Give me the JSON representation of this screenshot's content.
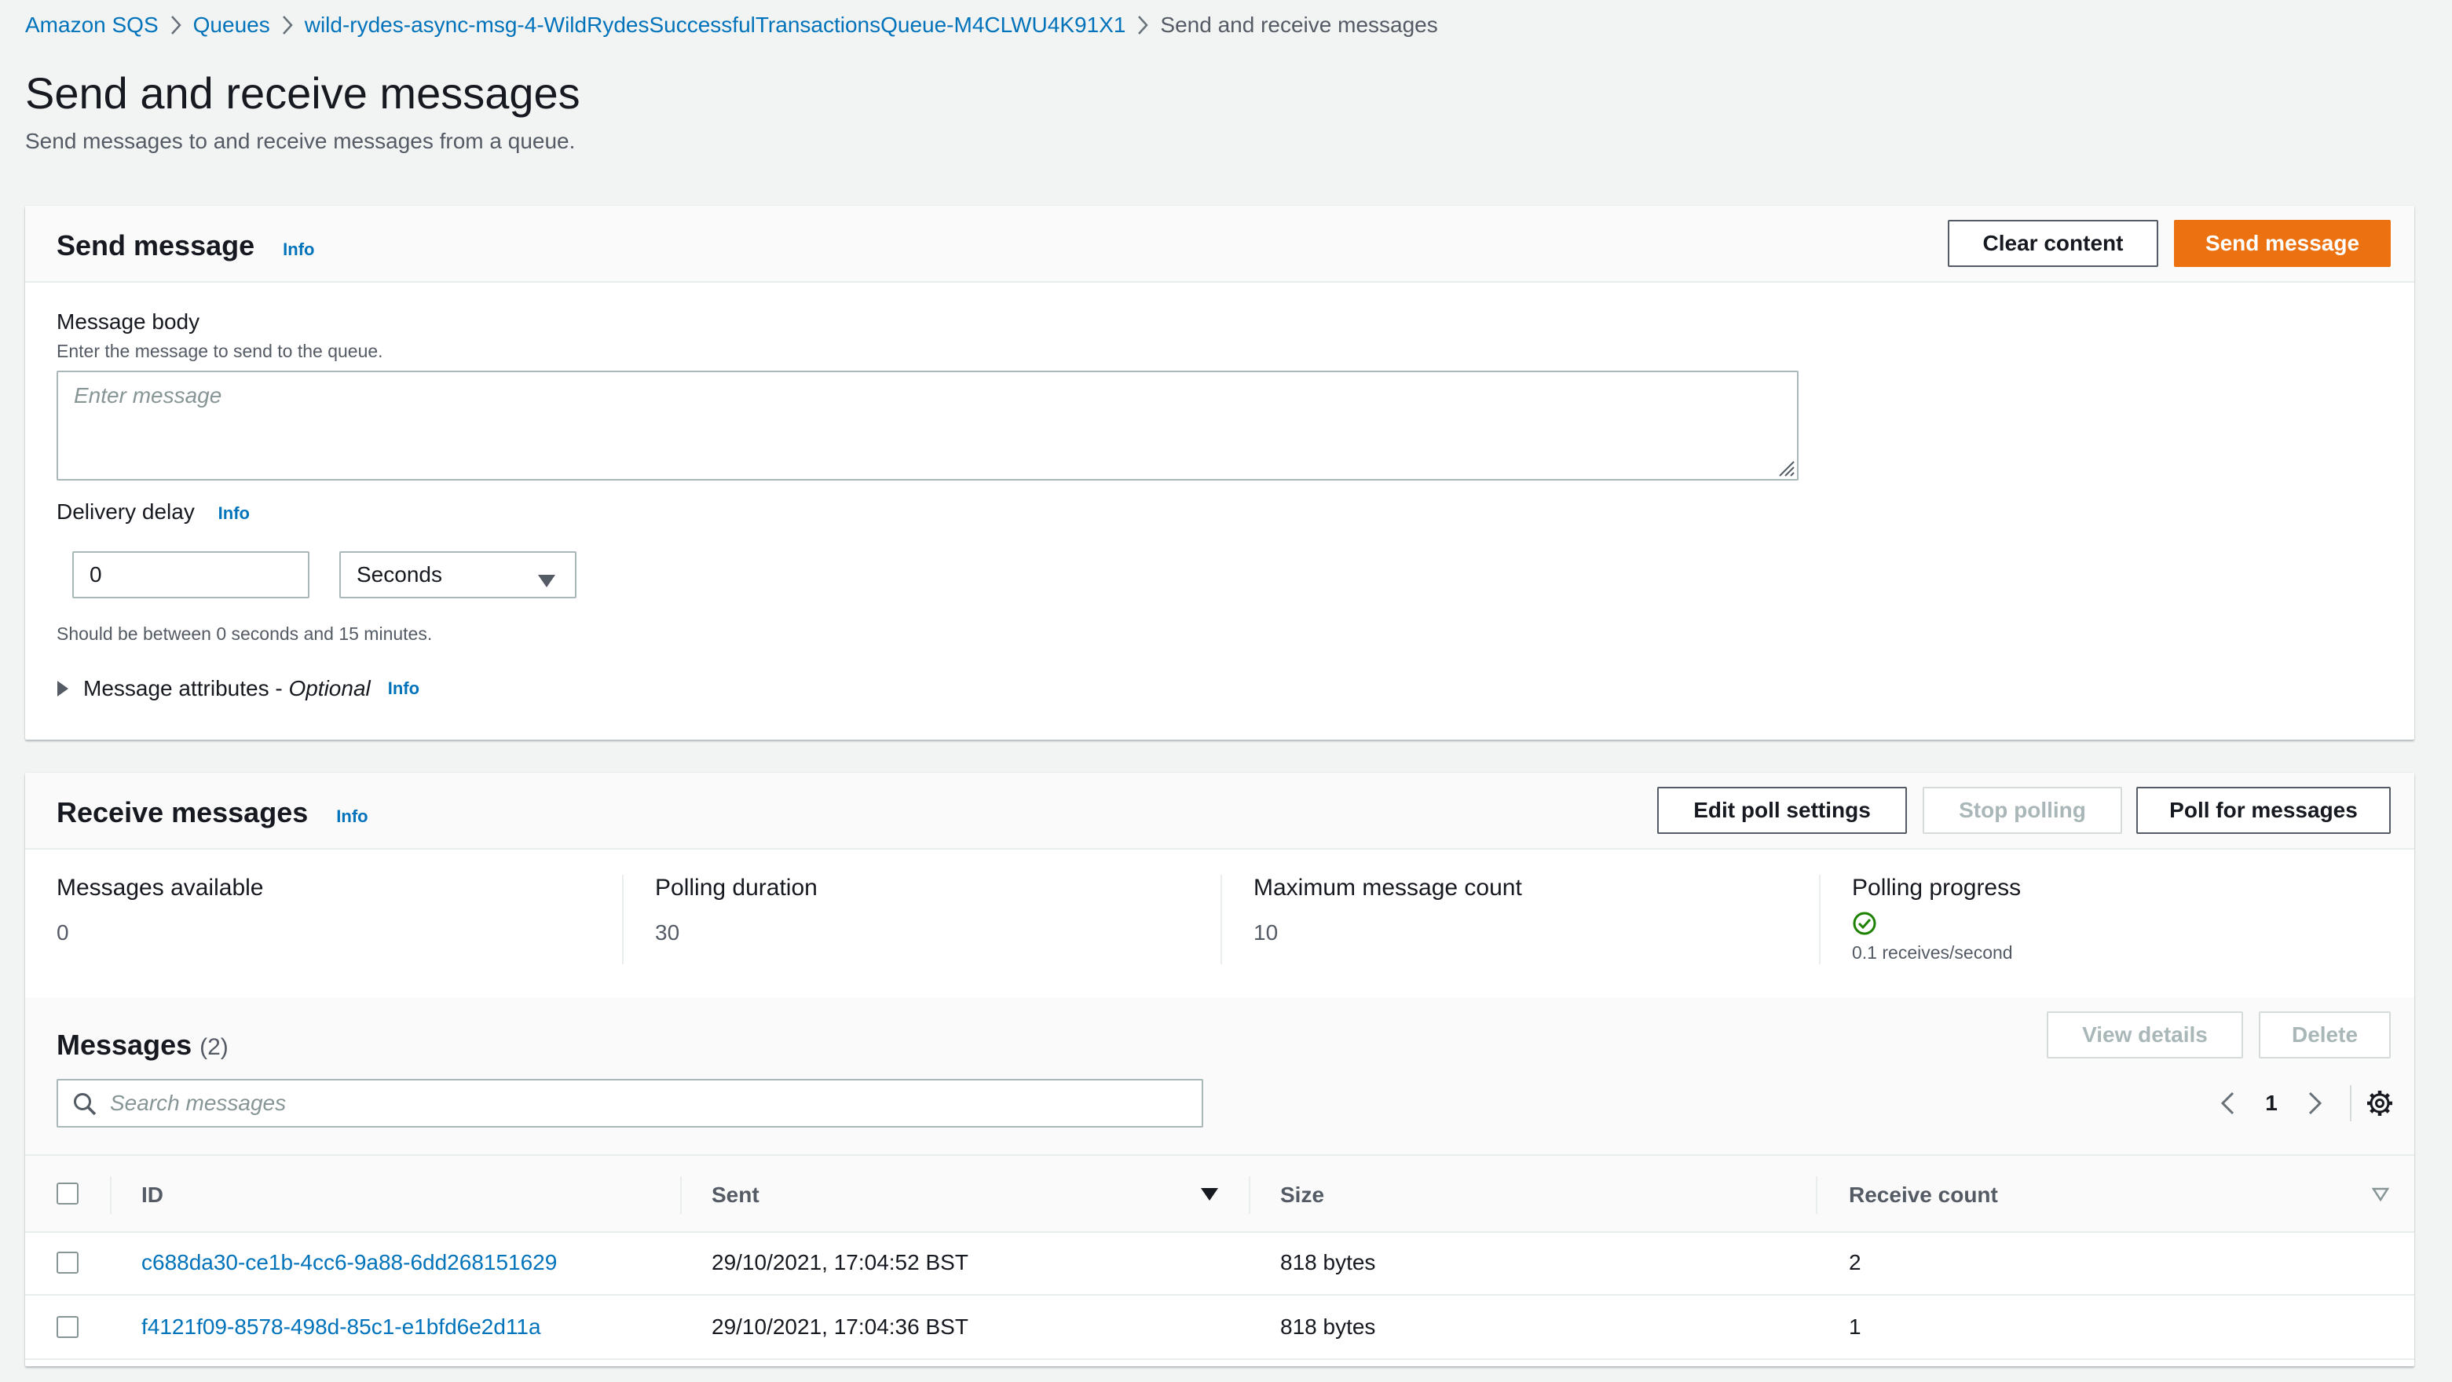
{
  "breadcrumb": {
    "items": [
      "Amazon SQS",
      "Queues",
      "wild-rydes-async-msg-4-WildRydesSuccessfulTransactionsQueue-M4CLWU4K91X1"
    ],
    "current": "Send and receive messages"
  },
  "page": {
    "title": "Send and receive messages",
    "description": "Send messages to and receive messages from a queue."
  },
  "send_panel": {
    "title": "Send message",
    "info": "Info",
    "clear_label": "Clear content",
    "send_label": "Send message",
    "body_label": "Message body",
    "body_hint": "Enter the message to send to the queue.",
    "body_placeholder": "Enter message",
    "body_value": "",
    "delay_label": "Delivery delay",
    "delay_info": "Info",
    "delay_value": "0",
    "delay_unit": "Seconds",
    "delay_hint": "Should be between 0 seconds and 15 minutes.",
    "attributes_label": "Message attributes - ",
    "attributes_optional": "Optional",
    "attributes_info": "Info"
  },
  "receive_panel": {
    "title": "Receive messages",
    "info": "Info",
    "edit_poll_label": "Edit poll settings",
    "stop_polling_label": "Stop polling",
    "poll_label": "Poll for messages",
    "stats": {
      "available_label": "Messages available",
      "available_value": "0",
      "duration_label": "Polling duration",
      "duration_value": "30",
      "max_count_label": "Maximum message count",
      "max_count_value": "10",
      "progress_label": "Polling progress",
      "progress_value": "0.1 receives/second"
    }
  },
  "messages": {
    "title": "Messages",
    "count": "(2)",
    "view_details_label": "View details",
    "delete_label": "Delete",
    "search_placeholder": "Search messages",
    "page": "1",
    "columns": [
      "ID",
      "Sent",
      "Size",
      "Receive count"
    ],
    "rows": [
      {
        "id": "c688da30-ce1b-4cc6-9a88-6dd268151629",
        "sent": "29/10/2021, 17:04:52 BST",
        "size": "818 bytes",
        "receive_count": "2"
      },
      {
        "id": "f4121f09-8578-498d-85c1-e1bfd6e2d11a",
        "sent": "29/10/2021, 17:04:36 BST",
        "size": "818 bytes",
        "receive_count": "1"
      }
    ]
  },
  "colors": {
    "link": "#0073bb",
    "primary": "#ec7211",
    "success": "#1d8102",
    "background": "#f2f3f3"
  }
}
